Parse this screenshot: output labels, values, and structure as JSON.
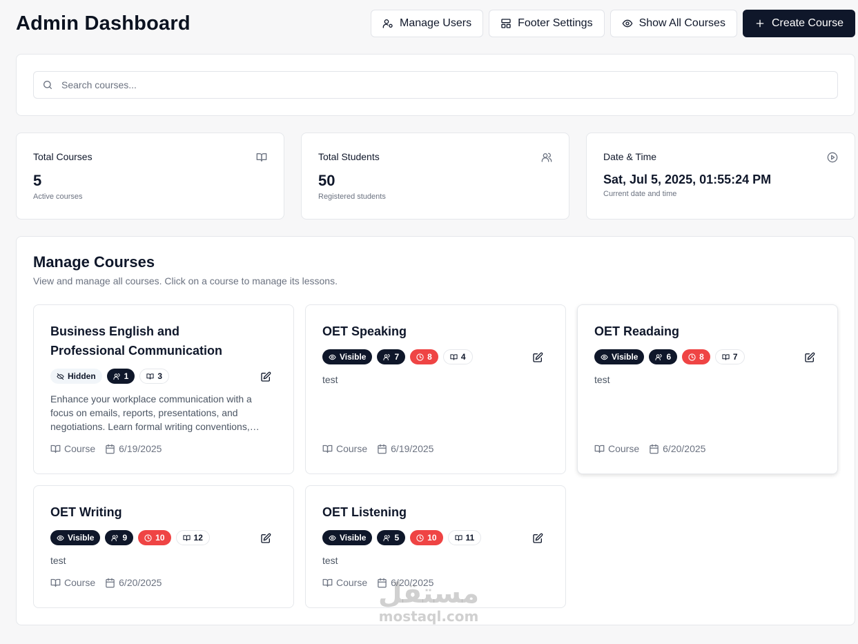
{
  "header": {
    "title": "Admin Dashboard",
    "buttons": {
      "manage_users": "Manage Users",
      "footer_settings": "Footer Settings",
      "show_all_courses": "Show All Courses",
      "create_course": "Create Course"
    }
  },
  "search": {
    "placeholder": "Search courses..."
  },
  "stats": {
    "total_courses": {
      "label": "Total Courses",
      "value": "5",
      "sub": "Active courses",
      "icon": "book-open-icon"
    },
    "total_students": {
      "label": "Total Students",
      "value": "50",
      "sub": "Registered students",
      "icon": "users-icon"
    },
    "date_time": {
      "label": "Date & Time",
      "value": "Sat, Jul 5, 2025, 01:55:24 PM",
      "sub": "Current date and time",
      "icon": "play-circle-icon"
    }
  },
  "manage": {
    "title": "Manage Courses",
    "description": "View and manage all courses. Click on a course to manage its lessons."
  },
  "courses": [
    {
      "title": "Business English and Professional Communication",
      "visibility": "Hidden",
      "students": "1",
      "lessons": "3",
      "description": "Enhance your workplace communication with a focus on emails, reports, presentations, and negotiations. Learn formal writing conventions, business vocabulary, and professional etiquette.",
      "type": "Course",
      "date": "6/19/2025"
    },
    {
      "title": "OET Speaking",
      "visibility": "Visible",
      "students": "7",
      "pending": "8",
      "lessons": "4",
      "description": "test",
      "type": "Course",
      "date": "6/19/2025"
    },
    {
      "title": "OET Readaing",
      "visibility": "Visible",
      "students": "6",
      "pending": "8",
      "lessons": "7",
      "description": "test",
      "type": "Course",
      "date": "6/20/2025"
    },
    {
      "title": "OET Writing",
      "visibility": "Visible",
      "students": "9",
      "pending": "10",
      "lessons": "12",
      "description": "test",
      "type": "Course",
      "date": "6/20/2025"
    },
    {
      "title": "OET Listening",
      "visibility": "Visible",
      "students": "5",
      "pending": "10",
      "lessons": "11",
      "description": "test",
      "type": "Course",
      "date": "6/20/2025"
    }
  ],
  "watermark": {
    "arabic": "مستقل",
    "latin": "mostaql.com"
  },
  "colors": {
    "primary": "#0f172a",
    "danger": "#ef4444",
    "muted": "#6b7280",
    "background": "#f7f7f8"
  }
}
